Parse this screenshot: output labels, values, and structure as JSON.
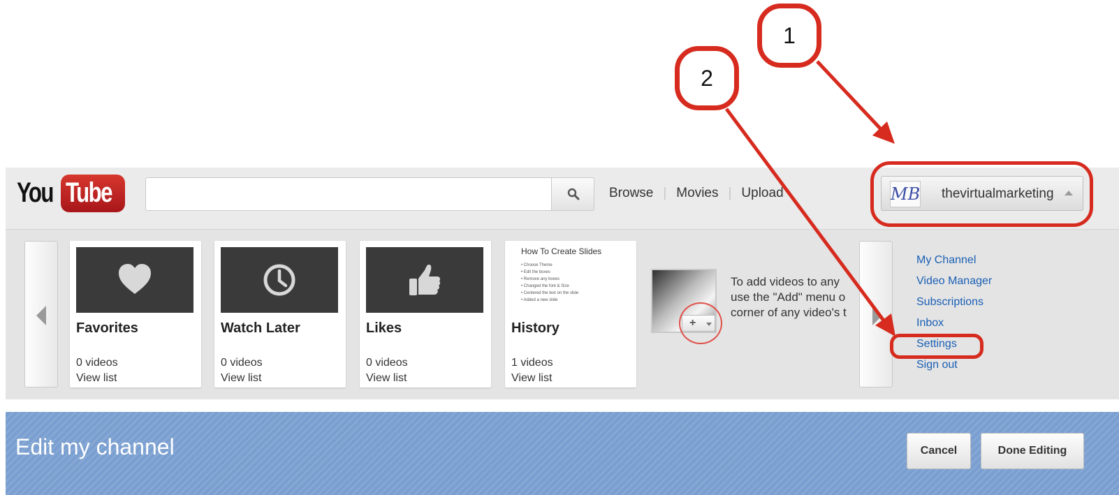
{
  "header": {
    "logo_you": "You",
    "logo_tube": "Tube",
    "search_placeholder": "",
    "nav": [
      "Browse",
      "Movies",
      "Upload"
    ],
    "account_name": "thevirtualmarketing",
    "avatar_text": "MB"
  },
  "guide": {
    "cards": [
      {
        "title": "Favorites",
        "count": "0 videos",
        "link": "View list",
        "icon": "heart-icon"
      },
      {
        "title": "Watch Later",
        "count": "0 videos",
        "link": "View list",
        "icon": "clock-icon"
      },
      {
        "title": "Likes",
        "count": "0 videos",
        "link": "View list",
        "icon": "thumbs-up-icon"
      },
      {
        "title": "History",
        "count": "1 videos",
        "link": "View list",
        "icon": "slide-thumbnail"
      }
    ],
    "history_thumb": {
      "title": "How To Create Slides",
      "bullets": [
        "Choose Theme",
        "Edit the boxes",
        "Remove any boxes",
        "Changed the font & Size",
        "Centered the text on the slide",
        "Added a new slide"
      ]
    },
    "add_help_button": "+",
    "add_help_lines": [
      "To add videos to any",
      "use the \"Add\" menu o",
      "corner of any video's t"
    ]
  },
  "account_menu": [
    "My Channel",
    "Video Manager",
    "Subscriptions",
    "Inbox",
    "Settings",
    "Sign out"
  ],
  "editbar": {
    "title": "Edit my channel",
    "cancel": "Cancel",
    "done": "Done Editing"
  },
  "annotations": {
    "callout_1": "1",
    "callout_2": "2",
    "color": "#d62b1e"
  },
  "colors": {
    "link": "#1a5fb4",
    "edit_bar": "#7a9fd0",
    "youtube_red": "#cc2a22"
  }
}
